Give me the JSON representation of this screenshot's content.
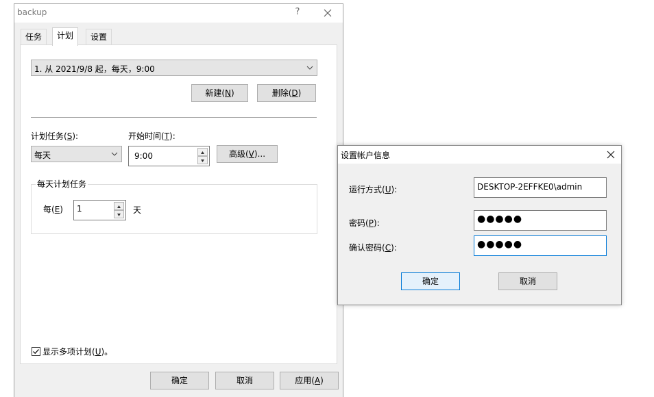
{
  "main_window": {
    "title": "backup",
    "help_label": "?",
    "tabs": [
      {
        "label": "任务"
      },
      {
        "label": "计划"
      },
      {
        "label": "设置"
      }
    ],
    "schedule_select": {
      "value": "1. 从 2021/9/8 起，每天，9:00"
    },
    "new_button": {
      "text": "新建(",
      "key": "N",
      "end": ")"
    },
    "delete_button": {
      "text": "删除(",
      "key": "D",
      "end": ")"
    },
    "schedule_task_label": {
      "text": "计划任务(",
      "key": "S",
      "end": "):"
    },
    "schedule_type": {
      "value": "每天"
    },
    "start_time_label": {
      "text": "开始时间(",
      "key": "T",
      "end": "):"
    },
    "start_time": {
      "value": "9:00"
    },
    "advanced_button": {
      "text": "高级(",
      "key": "V",
      "end": ")..."
    },
    "daily_group_title": "每天计划任务",
    "every_label": {
      "text": "每(",
      "key": "E",
      "end": ")"
    },
    "every_value": "1",
    "day_unit": "天",
    "show_multiple": {
      "text": "显示多项计划(",
      "key": "U",
      "end": ")。",
      "checked": true
    },
    "ok_button": "确定",
    "cancel_button": "取消",
    "apply_button": {
      "text": "应用(",
      "key": "A",
      "end": ")"
    }
  },
  "account_dialog": {
    "title": "设置帐户信息",
    "run_as_label": {
      "text": "运行方式(",
      "key": "U",
      "end": "):"
    },
    "run_as_value": "DESKTOP-2EFFKE0\\admin",
    "password_label": {
      "text": "密码(",
      "key": "P",
      "end": "):"
    },
    "password_mask": "●●●●●",
    "confirm_label": {
      "text": "确认密码(",
      "key": "C",
      "end": "):"
    },
    "confirm_mask": "●●●●●",
    "ok_button": "确定",
    "cancel_button": "取消"
  },
  "icons": {
    "close": "close-icon",
    "dropdown": "chevron-down-icon",
    "spin_up": "spin-up-icon",
    "spin_down": "spin-down-icon",
    "check": "checkmark-icon"
  },
  "colors": {
    "focus_border": "#0078d7",
    "button_face": "#e1e1e1",
    "window_bg": "#f0f0f0"
  }
}
